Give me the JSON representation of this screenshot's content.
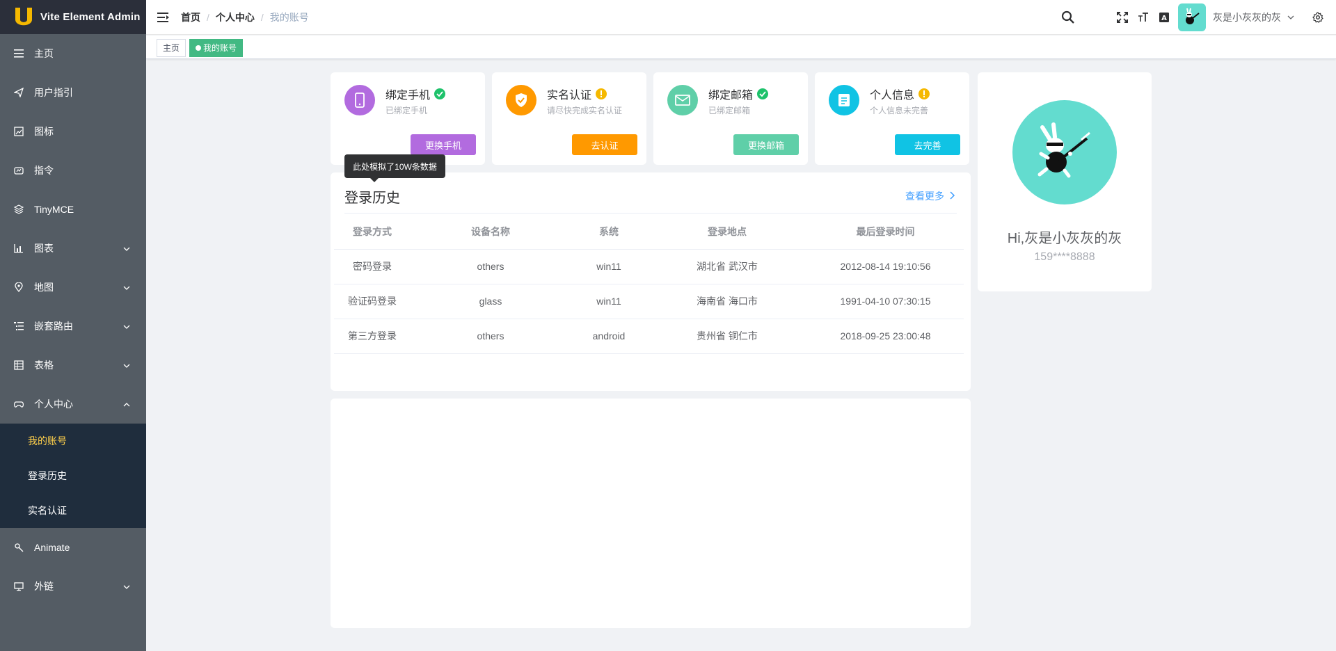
{
  "app": {
    "title": "Vite Element Admin"
  },
  "sidebar": {
    "items": [
      {
        "label": "主页",
        "icon": "list-icon"
      },
      {
        "label": "用户指引",
        "icon": "paper-plane-icon"
      },
      {
        "label": "图标",
        "icon": "picture-icon"
      },
      {
        "label": "指令",
        "icon": "directive-icon"
      },
      {
        "label": "TinyMCE",
        "icon": "layers-icon"
      },
      {
        "label": "图表",
        "icon": "chart-icon"
      },
      {
        "label": "地图",
        "icon": "location-icon"
      },
      {
        "label": "嵌套路由",
        "icon": "nested-list-icon"
      },
      {
        "label": "表格",
        "icon": "grid-icon"
      },
      {
        "label": "个人中心",
        "icon": "gamepad-icon"
      },
      {
        "label": "Animate",
        "icon": "magic-icon"
      },
      {
        "label": "外链",
        "icon": "monitor-icon"
      }
    ],
    "submenu": [
      {
        "label": "我的账号",
        "active": true
      },
      {
        "label": "登录历史",
        "active": false
      },
      {
        "label": "实名认证",
        "active": false
      }
    ],
    "colors": {
      "bg": "#545c64",
      "active_text": "#ffd04b",
      "submenu_bg": "#1f2d3d"
    }
  },
  "header": {
    "breadcrumb": [
      "首页",
      "个人中心",
      "我的账号"
    ],
    "user_name": "灰是小灰灰的灰"
  },
  "tags": {
    "items": [
      {
        "label": "主页",
        "active": false
      },
      {
        "label": "我的账号",
        "active": true
      }
    ],
    "active_color": "#42b983"
  },
  "cards": [
    {
      "title": "绑定手机",
      "subtitle": "已绑定手机",
      "button": "更换手机",
      "status": "done",
      "icon": "phone-icon",
      "color": "#b26bdf"
    },
    {
      "title": "实名认证",
      "subtitle": "请尽快完成实名认证",
      "button": "去认证",
      "status": "warning",
      "icon": "shield-check-icon",
      "color": "#ff9900"
    },
    {
      "title": "绑定邮箱",
      "subtitle": "已绑定邮箱",
      "button": "更换邮箱",
      "status": "done",
      "icon": "mail-icon",
      "color": "#5fcfa8"
    },
    {
      "title": "个人信息",
      "subtitle": "个人信息未完善",
      "button": "去完善",
      "status": "warning",
      "icon": "document-icon",
      "color": "#10c3e4"
    }
  ],
  "tooltip": "此处模拟了10W条数据",
  "login_history": {
    "title": "登录历史",
    "more": "查看更多",
    "columns": [
      "登录方式",
      "设备名称",
      "系统",
      "登录地点",
      "最后登录时间"
    ],
    "rows": [
      [
        "密码登录",
        "others",
        "win11",
        "湖北省 武汉市",
        "2012-08-14 19:10:56"
      ],
      [
        "验证码登录",
        "glass",
        "win11",
        "海南省 海口市",
        "1991-04-10 07:30:15"
      ],
      [
        "第三方登录",
        "others",
        "android",
        "贵州省 铜仁市",
        "2018-09-25 23:00:48"
      ]
    ]
  },
  "profile": {
    "greeting": "Hi,灰是小灰灰的灰",
    "phone": "159****8888"
  }
}
